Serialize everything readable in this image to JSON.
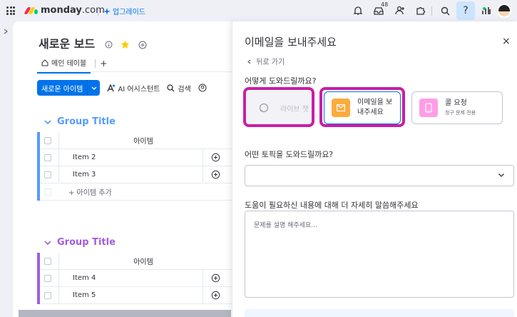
{
  "topbar": {
    "brand_name": "monday",
    "brand_suffix": ".com",
    "upgrade_label": "업그레이드",
    "inbox_count": "48",
    "help_symbol": "?",
    "colors": {
      "accent": "#0073ea",
      "highlight": "#c71fa6"
    }
  },
  "board": {
    "title": "새로운 보드",
    "tab_main": "메인 테이블",
    "tab_add": "+",
    "new_item_button": "새로운 아이템",
    "ai_assistant": "AI 어시스턴트",
    "search": "검색",
    "groups": [
      {
        "title": "Group Title",
        "column_header": "아이템",
        "rows": [
          "Item 2",
          "Item 3"
        ],
        "add_item": "+ 아이템 추가",
        "color": "#579bfc"
      },
      {
        "title": "Group Title",
        "column_header": "아이템",
        "rows": [
          "Item 4",
          "Item 5"
        ],
        "color": "#a25ddc"
      }
    ]
  },
  "panel": {
    "title": "이메일을 보내주세요",
    "close": "×",
    "back": "뒤로 가기",
    "question_help": "어떻게 도와드릴까요?",
    "options": {
      "live_chat": "라이브 챗",
      "email_line1": "이메일을 보",
      "email_line2": "내주세요",
      "call_title": "콜 요청",
      "call_sub": "청구 문제 전용"
    },
    "question_topic": "어떤 토픽을 도와드릴까요?",
    "question_details": "도움이 필요하신 내용에 대해 더 자세히 말씀해주세요",
    "details_placeholder": "문제를 설명 해주세요..."
  }
}
